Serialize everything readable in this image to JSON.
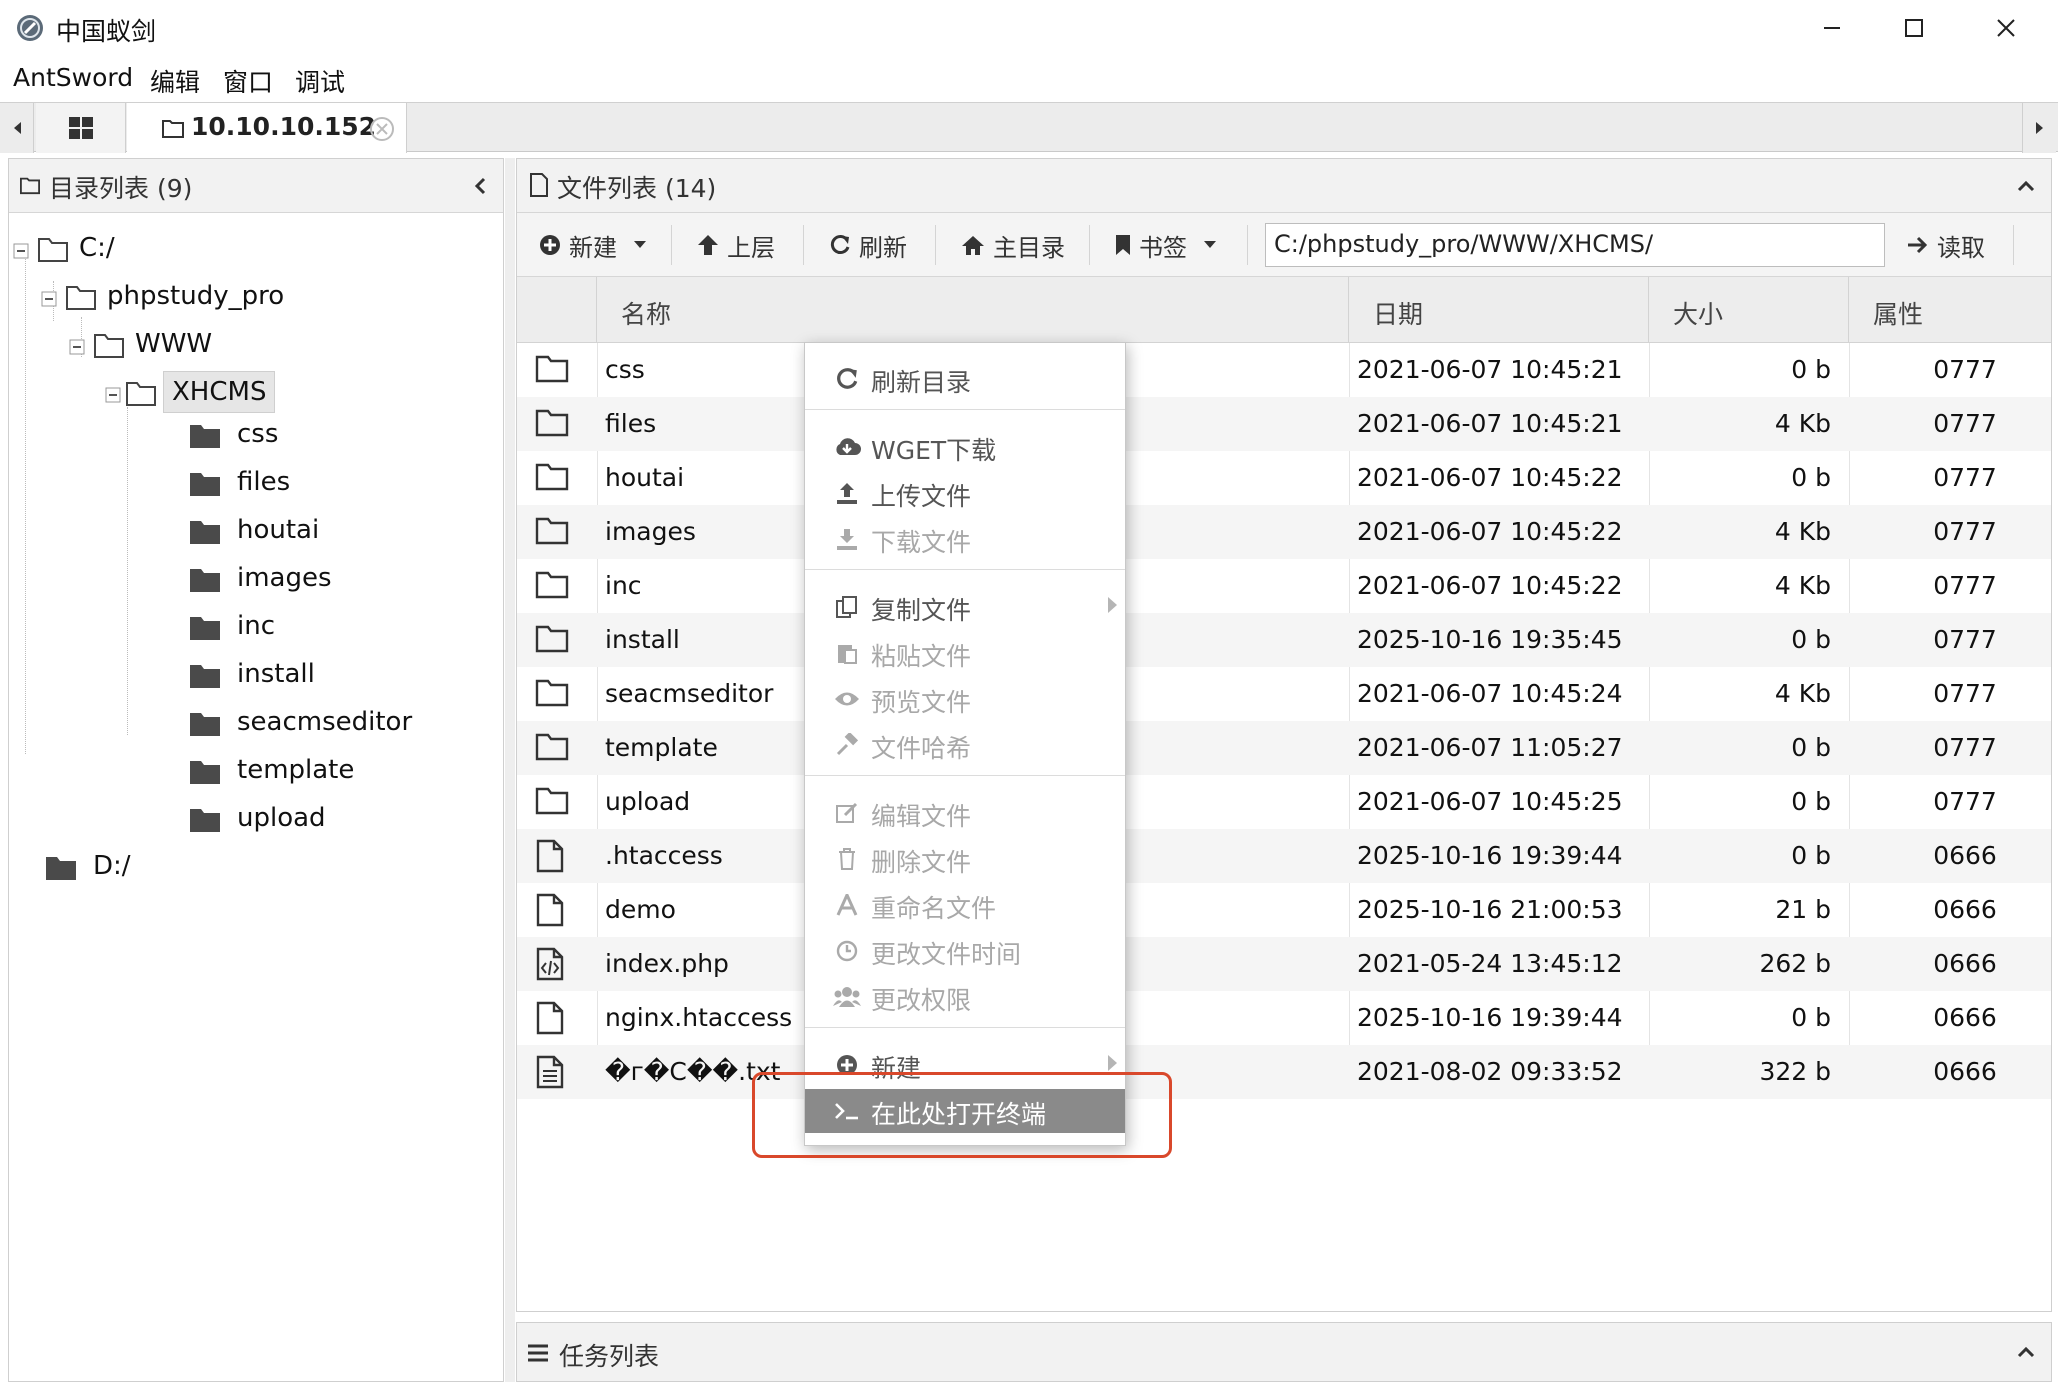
{
  "window": {
    "title": "中国蚁剑",
    "controls": [
      "minimize",
      "maximize",
      "close"
    ]
  },
  "menubar": {
    "items": [
      "AntSword",
      "编辑",
      "窗口",
      "调试"
    ]
  },
  "tabs": {
    "home_icon": "grid-icon",
    "active_label": "10.10.10.152"
  },
  "dir_panel": {
    "title": "目录列表 (9)",
    "tree": {
      "c_drive": "C:/",
      "phpstudy": "phpstudy_pro",
      "www": "WWW",
      "xhcms": "XHCMS",
      "children": [
        "css",
        "files",
        "houtai",
        "images",
        "inc",
        "install",
        "seacmseditor",
        "template",
        "upload"
      ],
      "d_drive": "D:/"
    }
  },
  "file_panel": {
    "title": "文件列表 (14)",
    "toolbar": {
      "new": "新建",
      "up": "上层",
      "refresh": "刷新",
      "home": "主目录",
      "bookmark": "书签",
      "path": "C:/phpstudy_pro/WWW/XHCMS/",
      "read": "读取"
    },
    "columns": [
      "名称",
      "日期",
      "大小",
      "属性"
    ],
    "rows": [
      {
        "type": "folder",
        "name": "css",
        "date": "2021-06-07 10:45:21",
        "size": "0 b",
        "attr": "0777"
      },
      {
        "type": "folder",
        "name": "files",
        "date": "2021-06-07 10:45:21",
        "size": "4 Kb",
        "attr": "0777"
      },
      {
        "type": "folder",
        "name": "houtai",
        "date": "2021-06-07 10:45:22",
        "size": "0 b",
        "attr": "0777"
      },
      {
        "type": "folder",
        "name": "images",
        "date": "2021-06-07 10:45:22",
        "size": "4 Kb",
        "attr": "0777"
      },
      {
        "type": "folder",
        "name": "inc",
        "date": "2021-06-07 10:45:22",
        "size": "4 Kb",
        "attr": "0777"
      },
      {
        "type": "folder",
        "name": "install",
        "date": "2025-10-16 19:35:45",
        "size": "0 b",
        "attr": "0777"
      },
      {
        "type": "folder",
        "name": "seacmseditor",
        "date": "2021-06-07 10:45:24",
        "size": "4 Kb",
        "attr": "0777"
      },
      {
        "type": "folder",
        "name": "template",
        "date": "2021-06-07 11:05:27",
        "size": "0 b",
        "attr": "0777"
      },
      {
        "type": "folder",
        "name": "upload",
        "date": "2021-06-07 10:45:25",
        "size": "0 b",
        "attr": "0777"
      },
      {
        "type": "file",
        "name": ".htaccess",
        "date": "2025-10-16 19:39:44",
        "size": "0 b",
        "attr": "0666"
      },
      {
        "type": "file",
        "name": "demo",
        "date": "2025-10-16 21:00:53",
        "size": "21 b",
        "attr": "0666"
      },
      {
        "type": "code",
        "name": "index.php",
        "date": "2021-05-24 13:45:12",
        "size": "262 b",
        "attr": "0666"
      },
      {
        "type": "file",
        "name": "nginx.htaccess",
        "date": "2025-10-16 19:39:44",
        "size": "0 b",
        "attr": "0666"
      },
      {
        "type": "text",
        "name": "�г�С��.txt",
        "date": "2021-08-02 09:33:52",
        "size": "322 b",
        "attr": "0666"
      }
    ]
  },
  "context_menu": {
    "refresh_dir": "刷新目录",
    "wget": "WGET下载",
    "upload": "上传文件",
    "download": "下载文件",
    "copy": "复制文件",
    "paste": "粘贴文件",
    "preview": "预览文件",
    "hash": "文件哈希",
    "edit": "编辑文件",
    "delete": "删除文件",
    "rename": "重命名文件",
    "change_time": "更改文件时间",
    "chmod": "更改权限",
    "new": "新建",
    "terminal": "在此处打开终端"
  },
  "task_panel": {
    "title": "任务列表"
  },
  "colors": {
    "highlight_border": "#d9482b",
    "menu_active_bg": "#8a8a8a",
    "disabled_text": "#a8a8a8"
  }
}
